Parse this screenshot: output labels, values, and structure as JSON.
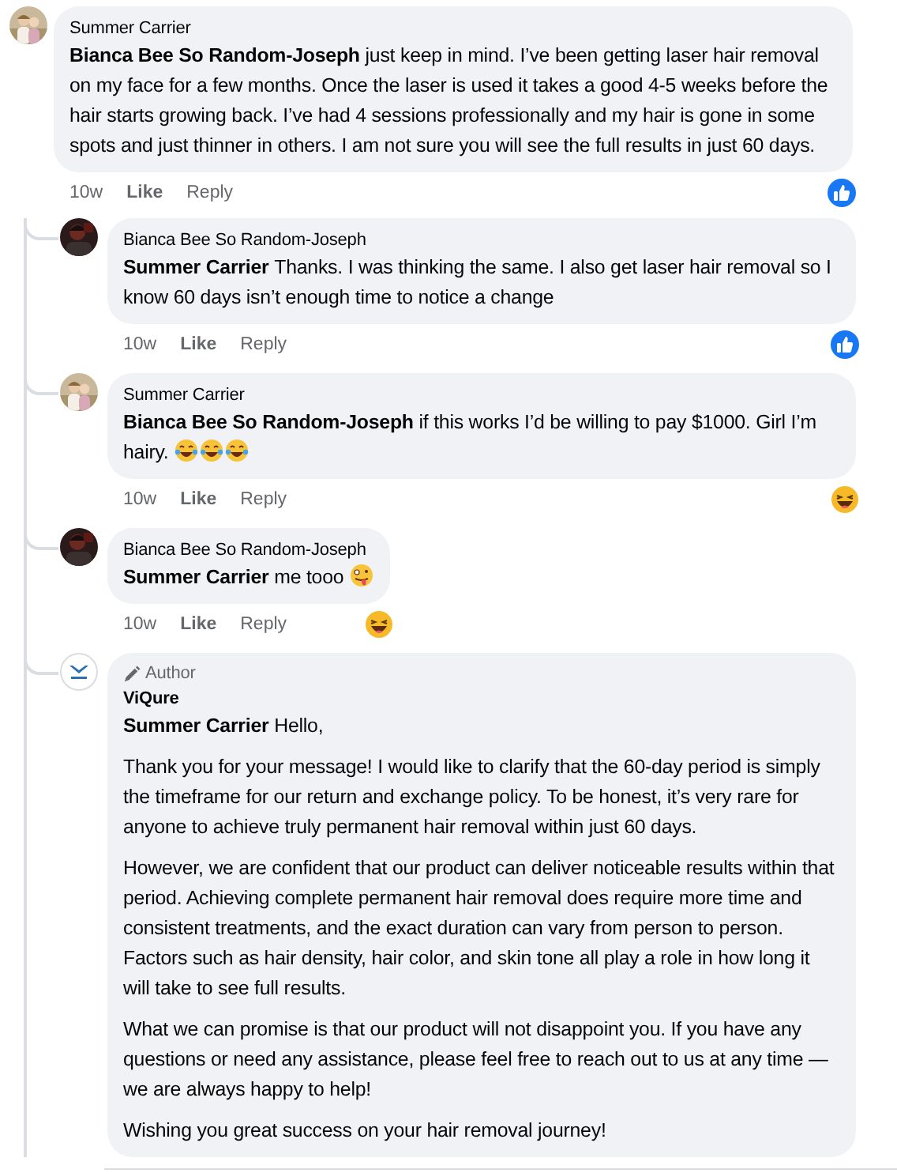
{
  "comments": [
    {
      "author": "Summer Carrier",
      "avatar": {
        "kind": "light-photo"
      },
      "mention": "Bianca Bee So Random-Joseph",
      "paragraphs": [
        "just keep in mind. I’ve been getting laser hair removal on my face for a few months. Once the laser is used it takes a good 4-5 weeks before the hair starts growing back. I’ve had 4 sessions professionally and my hair is gone in some spots and just thinner in others. I am not sure you will see the full results in just 60 days."
      ],
      "time": "10w",
      "actions": [
        "Like",
        "Reply"
      ],
      "reaction": {
        "kind": "like"
      },
      "children": [
        {
          "author": "Bianca Bee So Random-Joseph",
          "avatar": {
            "kind": "dark-photo"
          },
          "mention": "Summer Carrier",
          "paragraphs": [
            "Thanks. I was thinking the same. I also get laser hair removal so I know 60 days isn’t enough time to notice a change"
          ],
          "time": "10w",
          "actions": [
            "Like",
            "Reply"
          ],
          "reaction": {
            "kind": "like"
          }
        },
        {
          "author": "Summer Carrier",
          "avatar": {
            "kind": "light-photo"
          },
          "mention": "Bianca Bee So Random-Joseph",
          "paragraphs": [
            "if this works I’d be willing to pay $1000. Girl I’m hairy."
          ],
          "emojis": [
            {
              "kind": "tears-of-joy"
            },
            {
              "kind": "tears-of-joy"
            },
            {
              "kind": "tears-of-joy"
            }
          ],
          "time": "10w",
          "actions": [
            "Like",
            "Reply"
          ],
          "reaction": {
            "kind": "haha"
          }
        },
        {
          "author": "Bianca Bee So Random-Joseph",
          "avatar": {
            "kind": "dark-photo"
          },
          "mention": "Summer Carrier",
          "paragraphs": [
            "me tooo"
          ],
          "emojis": [
            {
              "kind": "zany"
            }
          ],
          "time": "10w",
          "actions": [
            "Like",
            "Reply"
          ],
          "reaction": {
            "kind": "haha"
          }
        },
        {
          "author": "ViQure",
          "badge": "Author",
          "avatar": {
            "kind": "logo"
          },
          "mention": "Summer Carrier",
          "paragraphs": [
            "Hello,",
            "Thank you for your message! I would like to clarify that the 60-day period is simply the timeframe for our return and exchange policy. To be honest, it’s very rare for anyone to achieve truly permanent hair removal within just 60 days.",
            "However, we are confident that our product can deliver noticeable results within that period. Achieving complete permanent hair removal does require more time and consistent treatments, and the exact duration can vary from person to person. Factors such as hair density, hair color, and skin tone all play a role in how long it will take to see full results.",
            "What we can promise is that our product will not disappoint you. If you have any questions or need any assistance, please feel free to reach out to us at any time — we are always happy to help!",
            "Wishing you great success on your hair removal journey!"
          ]
        }
      ]
    }
  ]
}
